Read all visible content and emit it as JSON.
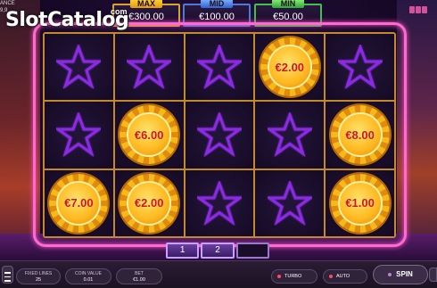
{
  "header": {
    "corner_left_lines": [
      "ANCE",
      "9,9"
    ],
    "logo": {
      "slot": "Slot",
      "catalog": "Catalog",
      "com": "com"
    }
  },
  "jackpots": [
    {
      "label": "MAX",
      "value": "€300.00",
      "color": "#f2b620"
    },
    {
      "label": "MID",
      "value": "€100.00",
      "color": "#4c7bd6"
    },
    {
      "label": "MIN",
      "value": "€50.00",
      "color": "#3ec24a"
    }
  ],
  "reels": {
    "rows": [
      [
        {
          "type": "star"
        },
        {
          "type": "star"
        },
        {
          "type": "star"
        },
        {
          "type": "coin",
          "value": "€2.00"
        },
        {
          "type": "star"
        }
      ],
      [
        {
          "type": "star"
        },
        {
          "type": "coin",
          "value": "€6.00"
        },
        {
          "type": "star"
        },
        {
          "type": "star"
        },
        {
          "type": "coin",
          "value": "€8.00"
        }
      ],
      [
        {
          "type": "coin",
          "value": "€7.00"
        },
        {
          "type": "coin",
          "value": "€2.00"
        },
        {
          "type": "star"
        },
        {
          "type": "star"
        },
        {
          "type": "coin",
          "value": "€1.00"
        }
      ]
    ],
    "star_color": "#8a2be2",
    "coin_text_color": "#d3121a"
  },
  "pager": {
    "tabs": [
      "1",
      "2",
      ""
    ]
  },
  "bottom_bar": {
    "fixed_lines": {
      "label": "FIXED LINES",
      "value": "25"
    },
    "coin_value": {
      "label": "COIN VALUE",
      "value": "0.01"
    },
    "bet": {
      "label": "BET",
      "value": "€1.00"
    },
    "turbo_label": "TURBO",
    "auto_label": "AUTO",
    "spin_label": "SPIN"
  }
}
